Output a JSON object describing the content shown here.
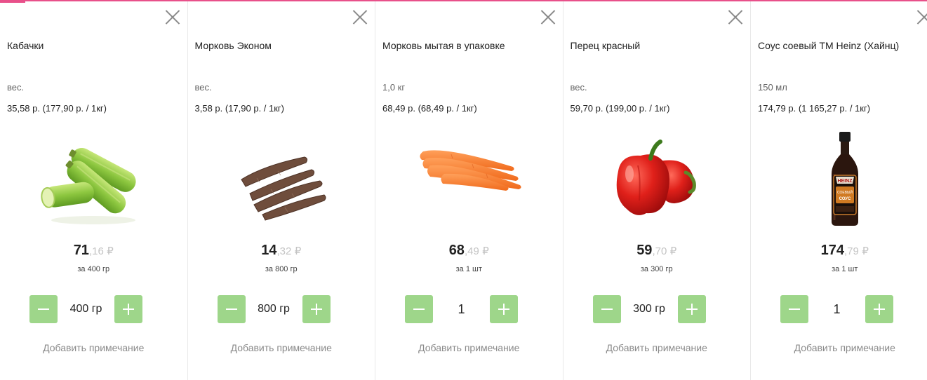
{
  "accent_color": "#e8508a",
  "button_color": "#9ed68a",
  "products": [
    {
      "name": "Кабачки",
      "weight": "вес.",
      "unit_price": "35,58 р. (177,90 р. / 1кг)",
      "image_icon": "zucchini-image",
      "price_whole": "71",
      "price_cents": ",16",
      "currency": "₽",
      "per_amount": "за 400 гр",
      "quantity": "400 гр",
      "note_label": "Добавить примечание"
    },
    {
      "name": "Морковь Эконом",
      "weight": "вес.",
      "unit_price": "3,58 р. (17,90 р. / 1кг)",
      "image_icon": "dirty-carrots-image",
      "price_whole": "14",
      "price_cents": ",32",
      "currency": "₽",
      "per_amount": "за 800 гр",
      "quantity": "800 гр",
      "note_label": "Добавить примечание"
    },
    {
      "name": "Морковь мытая в упаковке",
      "weight": "1,0 кг",
      "unit_price": "68,49 р. (68,49 р. / 1кг)",
      "image_icon": "carrots-image",
      "price_whole": "68",
      "price_cents": ",49",
      "currency": "₽",
      "per_amount": "за 1 шт",
      "quantity": "1",
      "note_label": "Добавить примечание"
    },
    {
      "name": "Перец красный",
      "weight": "вес.",
      "unit_price": "59,70 р. (199,00 р. / 1кг)",
      "image_icon": "red-pepper-image",
      "price_whole": "59",
      "price_cents": ",70",
      "currency": "₽",
      "per_amount": "за 300 гр",
      "quantity": "300 гр",
      "note_label": "Добавить примечание"
    },
    {
      "name": "Соус соевый ТМ Heinz (Хайнц)",
      "weight": "150 мл",
      "unit_price": "174,79 р. (1 165,27 р. / 1кг)",
      "image_icon": "soy-sauce-bottle-image",
      "price_whole": "174",
      "price_cents": ",79",
      "currency": "₽",
      "per_amount": "за 1 шт",
      "quantity": "1",
      "note_label": "Добавить примечание",
      "bottle_label": [
        "HEINZ",
        "СОЕВЫЙ",
        "СОУС"
      ]
    }
  ]
}
